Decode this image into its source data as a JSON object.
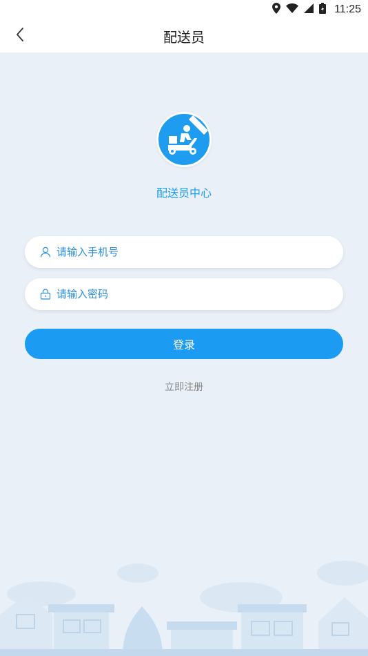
{
  "status_bar": {
    "time": "11:25",
    "icons": [
      "location-icon",
      "wifi-icon",
      "signal-icon",
      "battery-icon"
    ]
  },
  "nav": {
    "back_icon": "chevron-left-icon",
    "title": "配送员"
  },
  "brand": {
    "logo_icon": "delivery-scooter-icon",
    "name": "配送员中心",
    "accent_color": "#1e9cf0"
  },
  "form": {
    "phone": {
      "icon": "user-icon",
      "placeholder": "请输入手机号",
      "value": ""
    },
    "password": {
      "icon": "lock-icon",
      "placeholder": "请输入密码",
      "value": ""
    },
    "login_label": "登录",
    "register_label": "立即注册"
  }
}
